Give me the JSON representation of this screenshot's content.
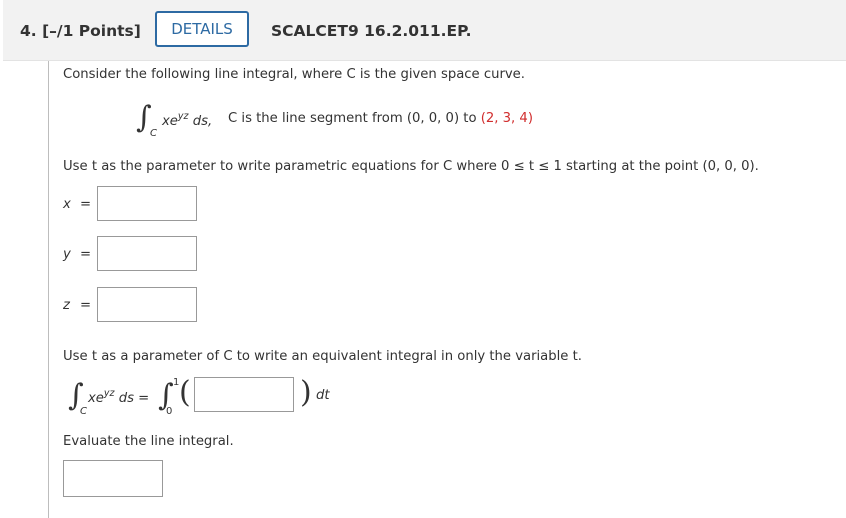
{
  "header": {
    "question_number": "4. [–/1 Points]",
    "details_label": "DETAILS",
    "problem_code": "SCALCET9 16.2.011.EP."
  },
  "problem": {
    "intro": "Consider the following line integral, where C is the given space curve.",
    "integral_sub": "C",
    "integrand_base": "xe",
    "integrand_exp": "yz",
    "integrand_ds": " ds,",
    "curve_text_pre": "C is the line segment from (0, 0, 0) to ",
    "curve_endpoint": "(2, 3, 4)",
    "param_instruction": "Use t as the parameter to write parametric equations for C where 0 ≤ t ≤ 1 starting at the point (0, 0, 0).",
    "x_label": "x",
    "y_label": "y",
    "z_label": "z",
    "equals": "=",
    "equiv_instruction": "Use t as a parameter of C to write an equivalent integral in only the variable t.",
    "lhs_base": "xe",
    "lhs_exp": "yz",
    "lhs_ds": " ds =",
    "lower_limit": "0",
    "upper_limit": "1",
    "dt": "dt",
    "evaluate_instruction": "Evaluate the line integral."
  },
  "inputs": {
    "x_value": "",
    "y_value": "",
    "z_value": "",
    "integrand_value": "",
    "answer_value": ""
  }
}
